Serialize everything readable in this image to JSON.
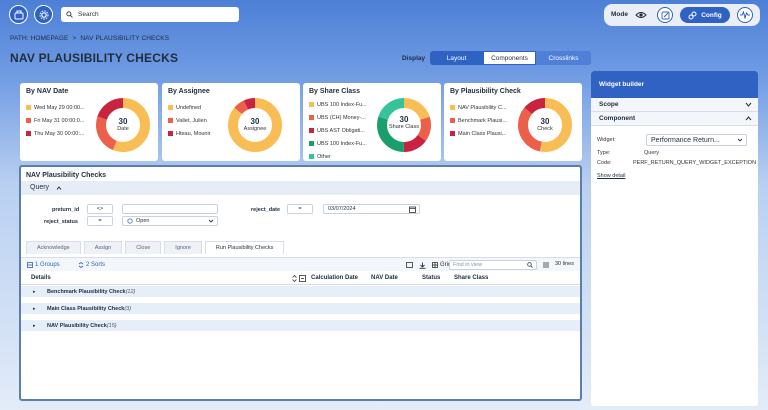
{
  "topbar": {
    "search_placeholder": "Search",
    "mode_label": "Mode",
    "config_label": "Config"
  },
  "breadcrumb": {
    "path_label": "PATH: HOMEPAGE",
    "separator": ">",
    "current": "NAV PLAUSIBILITY CHECKS"
  },
  "page_title": "NAV PLAUSIBILITY CHECKS",
  "display": {
    "label": "Display",
    "options": [
      "Layout",
      "Components",
      "Crosslinks"
    ],
    "selected": "Components"
  },
  "widgets": [
    {
      "title": "By NAV Date",
      "total": "30",
      "center_label": "Date",
      "legend": [
        {
          "label": "Wed May 29 00:00...",
          "color": "#f9bd56"
        },
        {
          "label": "Fri May 31 00:00:0...",
          "color": "#ec5f4b"
        },
        {
          "label": "Thu May 30 00:00:...",
          "color": "#c9243f"
        }
      ],
      "slices": [
        {
          "value": 0.56,
          "color": "#f9bd56"
        },
        {
          "value": 0.24,
          "color": "#ec5f4b"
        },
        {
          "value": 0.2,
          "color": "#c9243f"
        }
      ]
    },
    {
      "title": "By Assignee",
      "total": "30",
      "center_label": "Assignee",
      "legend": [
        {
          "label": "Undefined",
          "color": "#f9bd56"
        },
        {
          "label": "Vallet, Julien",
          "color": "#ec5f4b"
        },
        {
          "label": "Hteau, Mounir",
          "color": "#c9243f"
        }
      ],
      "slices": [
        {
          "value": 0.86,
          "color": "#f9bd56"
        },
        {
          "value": 0.07,
          "color": "#ec5f4b"
        },
        {
          "value": 0.07,
          "color": "#c9243f"
        }
      ]
    },
    {
      "title": "By Share Class",
      "total": "30",
      "center_label": "Share Class",
      "legend": [
        {
          "label": "UBS 100 Index-Fu...",
          "color": "#f9bd56"
        },
        {
          "label": "UBS (CH) Money-...",
          "color": "#ec5f4b"
        },
        {
          "label": "UBS AST Obligati...",
          "color": "#c9243f"
        },
        {
          "label": "UBS 100 Index-Fu...",
          "color": "#1a9e6e"
        },
        {
          "label": "Other",
          "color": "#34c39a"
        }
      ],
      "slices": [
        {
          "value": 0.2,
          "color": "#f9bd56"
        },
        {
          "value": 0.15,
          "color": "#ec5f4b"
        },
        {
          "value": 0.15,
          "color": "#c9243f"
        },
        {
          "value": 0.3,
          "color": "#1a9e6e"
        },
        {
          "value": 0.2,
          "color": "#34c39a"
        }
      ]
    },
    {
      "title": "By Plausibility Check",
      "total": "30",
      "center_label": "Check",
      "legend": [
        {
          "label": "NAV Plausibility C...",
          "color": "#f9bd56"
        },
        {
          "label": "Benchmark Plausi...",
          "color": "#ec5f4b"
        },
        {
          "label": "Main Class Plausi...",
          "color": "#c9243f"
        }
      ],
      "slices": [
        {
          "value": 0.53,
          "color": "#f9bd56"
        },
        {
          "value": 0.33,
          "color": "#ec5f4b"
        },
        {
          "value": 0.14,
          "color": "#c9243f"
        }
      ]
    }
  ],
  "widget_builder": {
    "title": "Widget builder",
    "sections": {
      "scope": "Scope",
      "component": "Component"
    },
    "fields": {
      "widget_label": "Widget:",
      "widget_value": "Performance Return...",
      "type_label": "Type:",
      "type_value": "Query",
      "code_label": "Code:",
      "code_value": "PERF_RETURN_QUERY_WIDGET_EXCEPTION"
    },
    "show_detail": "Show detail"
  },
  "main_panel": {
    "title": "NAV Plausibility Checks",
    "query_label": "Query",
    "filters": {
      "preturn_id": {
        "label": "preturn_id",
        "op": "<>",
        "value": ""
      },
      "reject_date": {
        "label": "reject_date",
        "op": "=",
        "value": "03/07/2024"
      },
      "reject_status": {
        "label": "reject_status",
        "op": "=",
        "value": "Open"
      }
    },
    "actions": [
      "Acknowledge",
      "Assign",
      "Close",
      "Ignore",
      "Run Plausibility Checks"
    ],
    "active_action": "Run Plausibility Checks",
    "toolbar": {
      "groups": "1 Groups",
      "sorts": "2 Sorts",
      "grid_label": "Grid",
      "find_placeholder": "Find in view",
      "lines": "30 lines"
    },
    "columns": [
      "Details",
      "Calculation Date",
      "NAV Date",
      "Status",
      "Share Class"
    ],
    "groups": [
      {
        "name": "Benchmark Plausibility Check",
        "count": "(12)"
      },
      {
        "name": "Main Class Plausibility Check",
        "count": "(3)"
      },
      {
        "name": "NAV Plausibility Check",
        "count": "(15)"
      }
    ]
  }
}
